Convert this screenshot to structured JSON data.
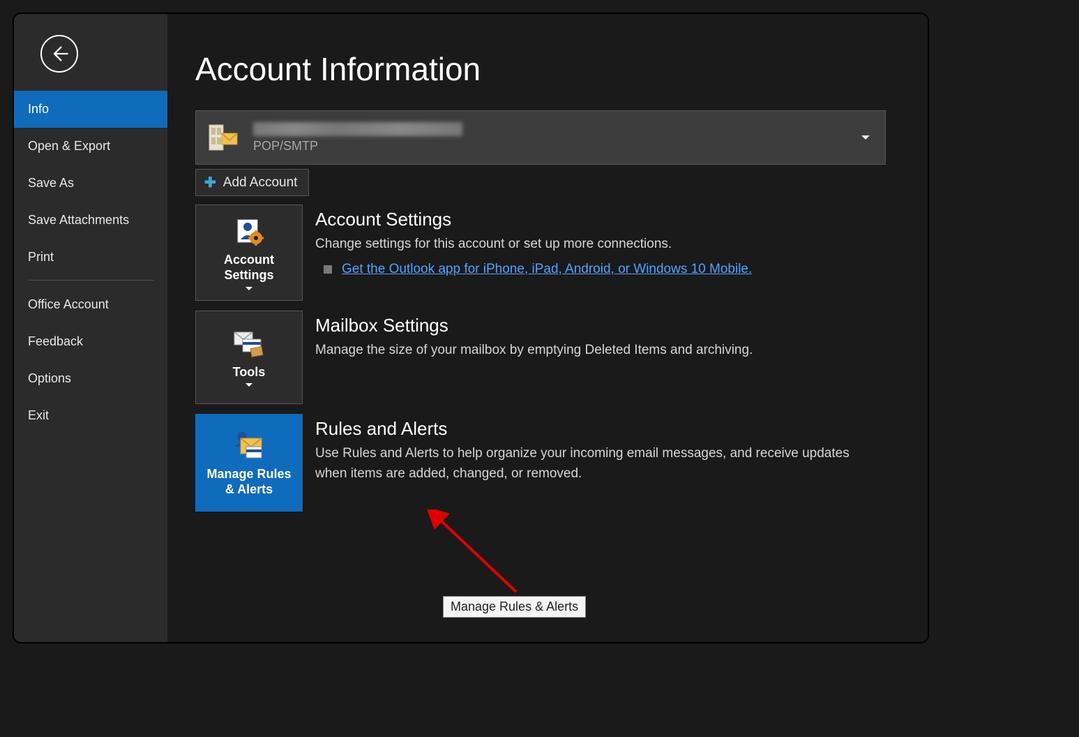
{
  "sidebar": {
    "items": [
      {
        "label": "Info",
        "selected": true
      },
      {
        "label": "Open & Export",
        "selected": false
      },
      {
        "label": "Save As",
        "selected": false
      },
      {
        "label": "Save Attachments",
        "selected": false
      },
      {
        "label": "Print",
        "selected": false
      }
    ],
    "lowerItems": [
      {
        "label": "Office Account"
      },
      {
        "label": "Feedback"
      },
      {
        "label": "Options"
      },
      {
        "label": "Exit"
      }
    ]
  },
  "main": {
    "title": "Account Information",
    "account": {
      "type": "POP/SMTP"
    },
    "addAccount": "Add Account",
    "sections": [
      {
        "tileLabel": "Account Settings",
        "title": "Account Settings",
        "desc": "Change settings for this account or set up more connections.",
        "link": "Get the Outlook app for iPhone, iPad, Android, or Windows 10 Mobile."
      },
      {
        "tileLabel": "Tools",
        "title": "Mailbox Settings",
        "desc": "Manage the size of your mailbox by emptying Deleted Items and archiving."
      },
      {
        "tileLabel": "Manage Rules & Alerts",
        "title": "Rules and Alerts",
        "desc": "Use Rules and Alerts to help organize your incoming email messages, and receive updates when items are added, changed, or removed."
      }
    ],
    "tooltip": "Manage Rules & Alerts"
  }
}
